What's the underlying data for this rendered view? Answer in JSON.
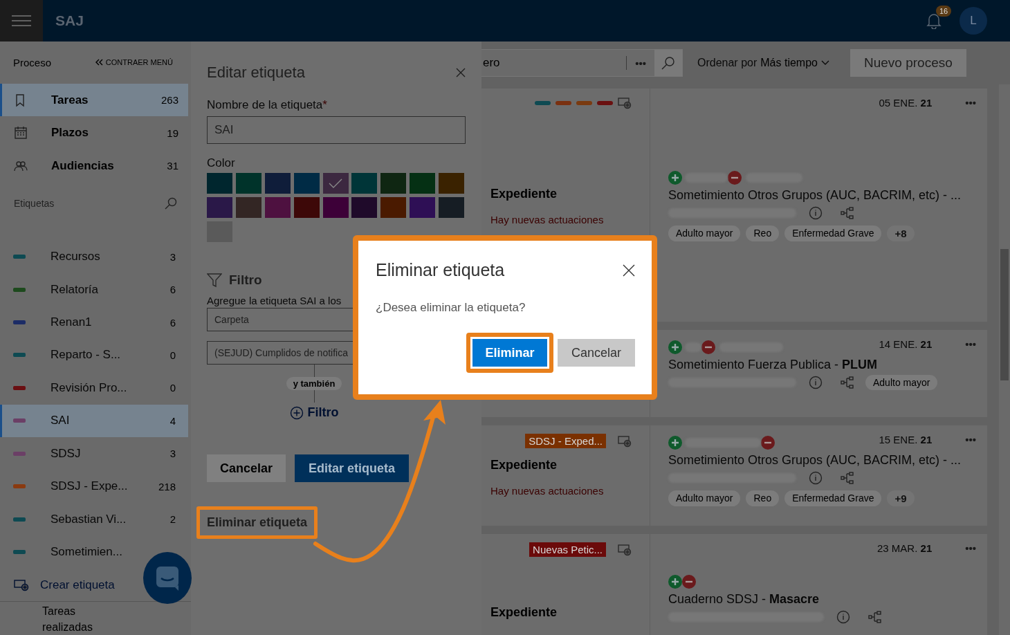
{
  "header": {
    "app_name": "SAJ",
    "notifications": "16",
    "avatar": "L"
  },
  "sidebar": {
    "section": "Proceso",
    "collapse": "CONTRAER MENÚ",
    "nav": [
      {
        "label": "Tareas",
        "count": "263",
        "selected": true
      },
      {
        "label": "Plazos",
        "count": "19",
        "selected": false
      },
      {
        "label": "Audiencias",
        "count": "31",
        "selected": false
      }
    ],
    "labels_heading": "Etiquetas",
    "labels": [
      {
        "name": "Recursos",
        "count": "3",
        "color": "#0e4a52",
        "selected": false
      },
      {
        "name": "Relatoría",
        "count": "6",
        "color": "#1d4a1d",
        "selected": false
      },
      {
        "name": "Renan1",
        "count": "6",
        "color": "#1c2c66",
        "selected": false
      },
      {
        "name": "Reparto - S...",
        "count": "0",
        "color": "#0e4a52",
        "selected": false
      },
      {
        "name": "Revisión Pro...",
        "count": "0",
        "color": "#6a0f12",
        "selected": false
      },
      {
        "name": "SAI",
        "count": "4",
        "color": "#6b3f66",
        "selected": true
      },
      {
        "name": "SDSJ",
        "count": "3",
        "color": "#6b3f66",
        "selected": false
      },
      {
        "name": "SDSJ - Expe...",
        "count": "218",
        "color": "#8a3a10",
        "selected": false
      },
      {
        "name": "Sebastian Vi...",
        "count": "2",
        "color": "#0e4a52",
        "selected": false
      },
      {
        "name": "Sometimien...",
        "color": "#0e4a52",
        "selected": false
      }
    ],
    "create_label": "Crear etiqueta",
    "footer": "Tareas realizadas"
  },
  "edit_panel": {
    "title": "Editar etiqueta",
    "name_label": "Nombre de la etiqueta",
    "required_mark": "*",
    "name_value": "SAI",
    "color_label": "Color",
    "swatches": [
      {
        "color": "#00262e",
        "selected": false
      },
      {
        "color": "#00332a",
        "selected": false
      },
      {
        "color": "#0f1d3a",
        "selected": false
      },
      {
        "color": "#002b45",
        "selected": false
      },
      {
        "color": "#3c2840",
        "selected": true
      },
      {
        "color": "#003538",
        "selected": false
      },
      {
        "color": "#0f2612",
        "selected": false
      },
      {
        "color": "#053014",
        "selected": false
      },
      {
        "color": "#3a2200",
        "selected": false
      },
      {
        "color": "#2a1848",
        "selected": false
      },
      {
        "color": "#332624",
        "selected": false
      },
      {
        "color": "#4e1140",
        "selected": false
      },
      {
        "color": "#3d0808",
        "selected": false
      },
      {
        "color": "#3d0038",
        "selected": false
      },
      {
        "color": "#1f0a2a",
        "selected": false
      },
      {
        "color": "#4a1a00",
        "selected": false
      },
      {
        "color": "#2e0f55",
        "selected": false
      },
      {
        "color": "#161d24",
        "selected": false
      },
      {
        "color": "#5a5a5a",
        "selected": false
      }
    ],
    "filter_heading": "Filtro",
    "filter_hint": "Agregue la etiqueta SAI a los",
    "filter_fields": [
      "Carpeta",
      "(SEJUD) Cumplidos de notifica"
    ],
    "connector": "y también",
    "add_filter": "Filtro",
    "cancel": "Cancelar",
    "submit": "Editar etiqueta",
    "delete": "Eliminar etiqueta"
  },
  "toolbar": {
    "search_placeholder": "ero",
    "more": "•••",
    "sort_label": "Ordenar por",
    "sort_value": "Más tiempo",
    "new_button": "Nuevo proceso"
  },
  "cards": [
    {
      "labels": [
        {
          "color": "#0e4a52"
        },
        {
          "color": "#7a3010"
        },
        {
          "color": "#7a3a10"
        },
        {
          "color": "#6a1010"
        }
      ],
      "menu": "•••",
      "expediente": "Expediente",
      "alert": "Hay nuevas actuaciones",
      "date": "05 ENE. **21**",
      "title": "Sometimiento Otros Grupos (AUC, BACRIM, etc) - ...",
      "chips": [
        "Adulto mayor",
        "Reo",
        "Enfermedad Grave"
      ],
      "more": "+8"
    },
    {
      "menu": "•••",
      "date": "14 ENE. **21**",
      "title": "Sometimiento Fuerza Publica - **PLUM**",
      "inline_chip": "Adulto mayor"
    },
    {
      "menu": "•••",
      "tag": {
        "text": "SDSJ - Exped...",
        "color": "#7a3000"
      },
      "expediente": "Expediente",
      "alert": "Hay nuevas actuaciones",
      "date": "15 ENE. **21**",
      "title": "Sometimiento Otros Grupos (AUC, BACRIM, etc) - ...",
      "chips": [
        "Adulto mayor",
        "Reo",
        "Enfermedad Grave"
      ],
      "more": "+9"
    },
    {
      "menu": "•••",
      "tag": {
        "text": "Nuevas Petic...",
        "color": "#6b0a0a"
      },
      "expediente": "Expediente",
      "date": "23 MAR. **21**",
      "title": "Cuaderno SDSJ - **Masacre**"
    }
  ],
  "dialog": {
    "title": "Eliminar etiqueta",
    "question": "¿Desea eliminar la etiqueta?",
    "confirm": "Eliminar",
    "cancel": "Cancelar"
  }
}
